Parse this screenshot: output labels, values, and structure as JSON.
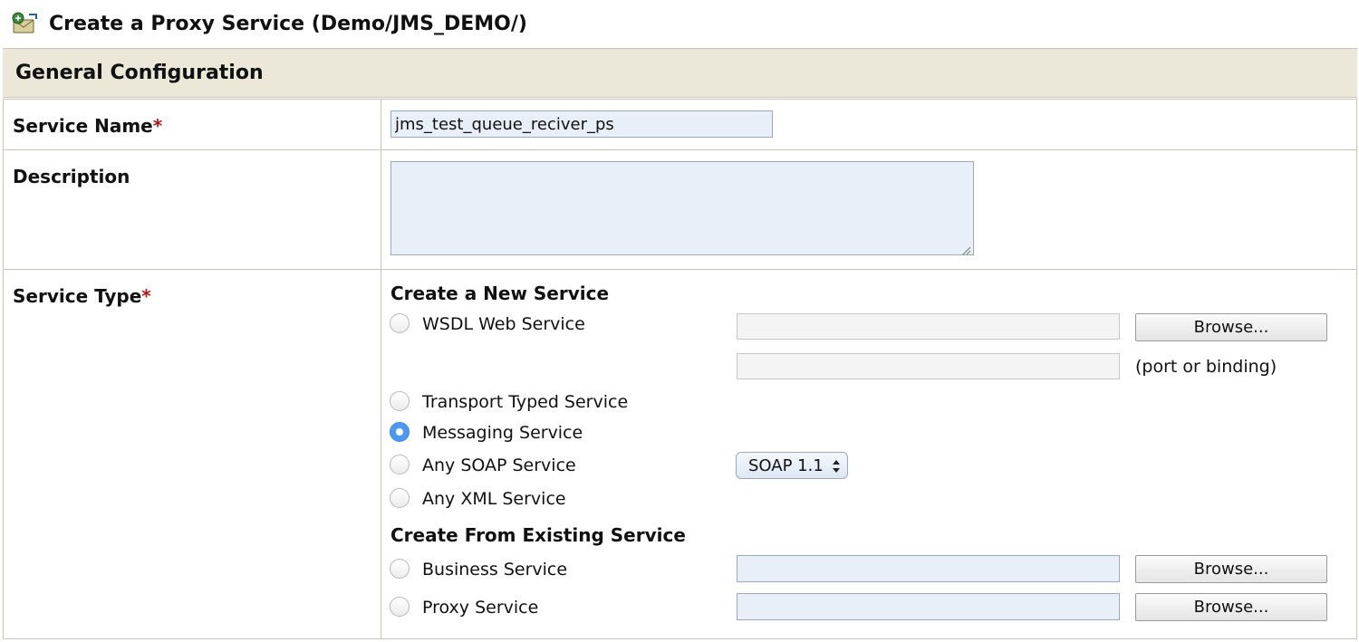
{
  "page": {
    "title": "Create a Proxy Service (Demo/JMS_DEMO/)"
  },
  "section": {
    "title": "General Configuration"
  },
  "form": {
    "service_name": {
      "label": "Service Name",
      "required_mark": "*",
      "value": "jms_test_queue_reciver_ps"
    },
    "description": {
      "label": "Description",
      "value": ""
    },
    "service_type": {
      "label": "Service Type",
      "required_mark": "*",
      "create_new_title": "Create a New Service",
      "options": {
        "wsdl": "WSDL Web Service",
        "transport_typed": "Transport Typed Service",
        "messaging": "Messaging Service",
        "any_soap": "Any SOAP Service",
        "any_xml": "Any XML Service"
      },
      "selected": "messaging",
      "wsdl_browse_label": "Browse...",
      "wsdl_port_hint": "(port or binding)",
      "soap_version_selected": "SOAP 1.1",
      "create_existing_title": "Create From Existing Service",
      "existing_options": {
        "business": "Business Service",
        "proxy": "Proxy Service"
      },
      "business_browse_label": "Browse...",
      "proxy_browse_label": "Browse..."
    }
  },
  "colors": {
    "section_bg": "#ebe8d9",
    "field_bg": "#e8eff8",
    "required": "#b01616",
    "radio_selected": "#4a98f0"
  }
}
